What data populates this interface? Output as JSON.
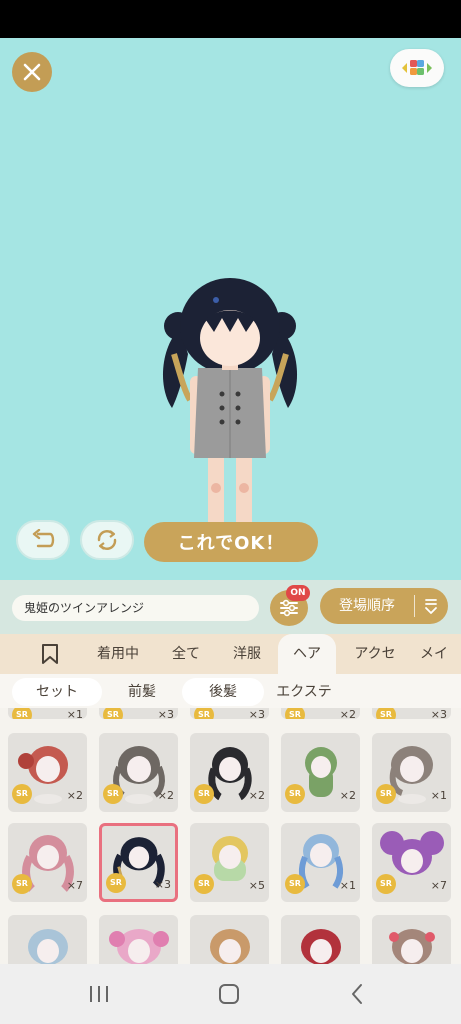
{
  "ok_button_label": "これでOK！",
  "item_name": "鬼姫のツインアレンジ",
  "filter_badge": "ON",
  "sort_label": "登場順序",
  "tabs": [
    "着用中",
    "全て",
    "洋服",
    "ヘア",
    "アクセ",
    "メイク"
  ],
  "active_tab": "ヘア",
  "subtabs": [
    "セット",
    "前髪",
    "後髪",
    "エクステ"
  ],
  "active_subtab": "後髪",
  "rarity_label": "SR",
  "row0_counts": [
    "×1",
    "×3",
    "×3",
    "×2",
    "×3"
  ],
  "row1_counts": [
    "×2",
    "×2",
    "×2",
    "×2",
    "×1"
  ],
  "row2_counts": [
    "×7",
    "×3",
    "×5",
    "×1",
    "×7"
  ],
  "colors": {
    "stage_bg": "#a5e5e3",
    "gold_accent": "#c9a45a",
    "badge_red": "#e04848",
    "selected_border": "#e9707f"
  },
  "icons": [
    "close-icon",
    "palette-icon",
    "undo-icon",
    "reload-icon",
    "filter-icon",
    "sort-icon",
    "bookmark-icon",
    "recent-apps-icon",
    "home-icon",
    "back-icon"
  ]
}
